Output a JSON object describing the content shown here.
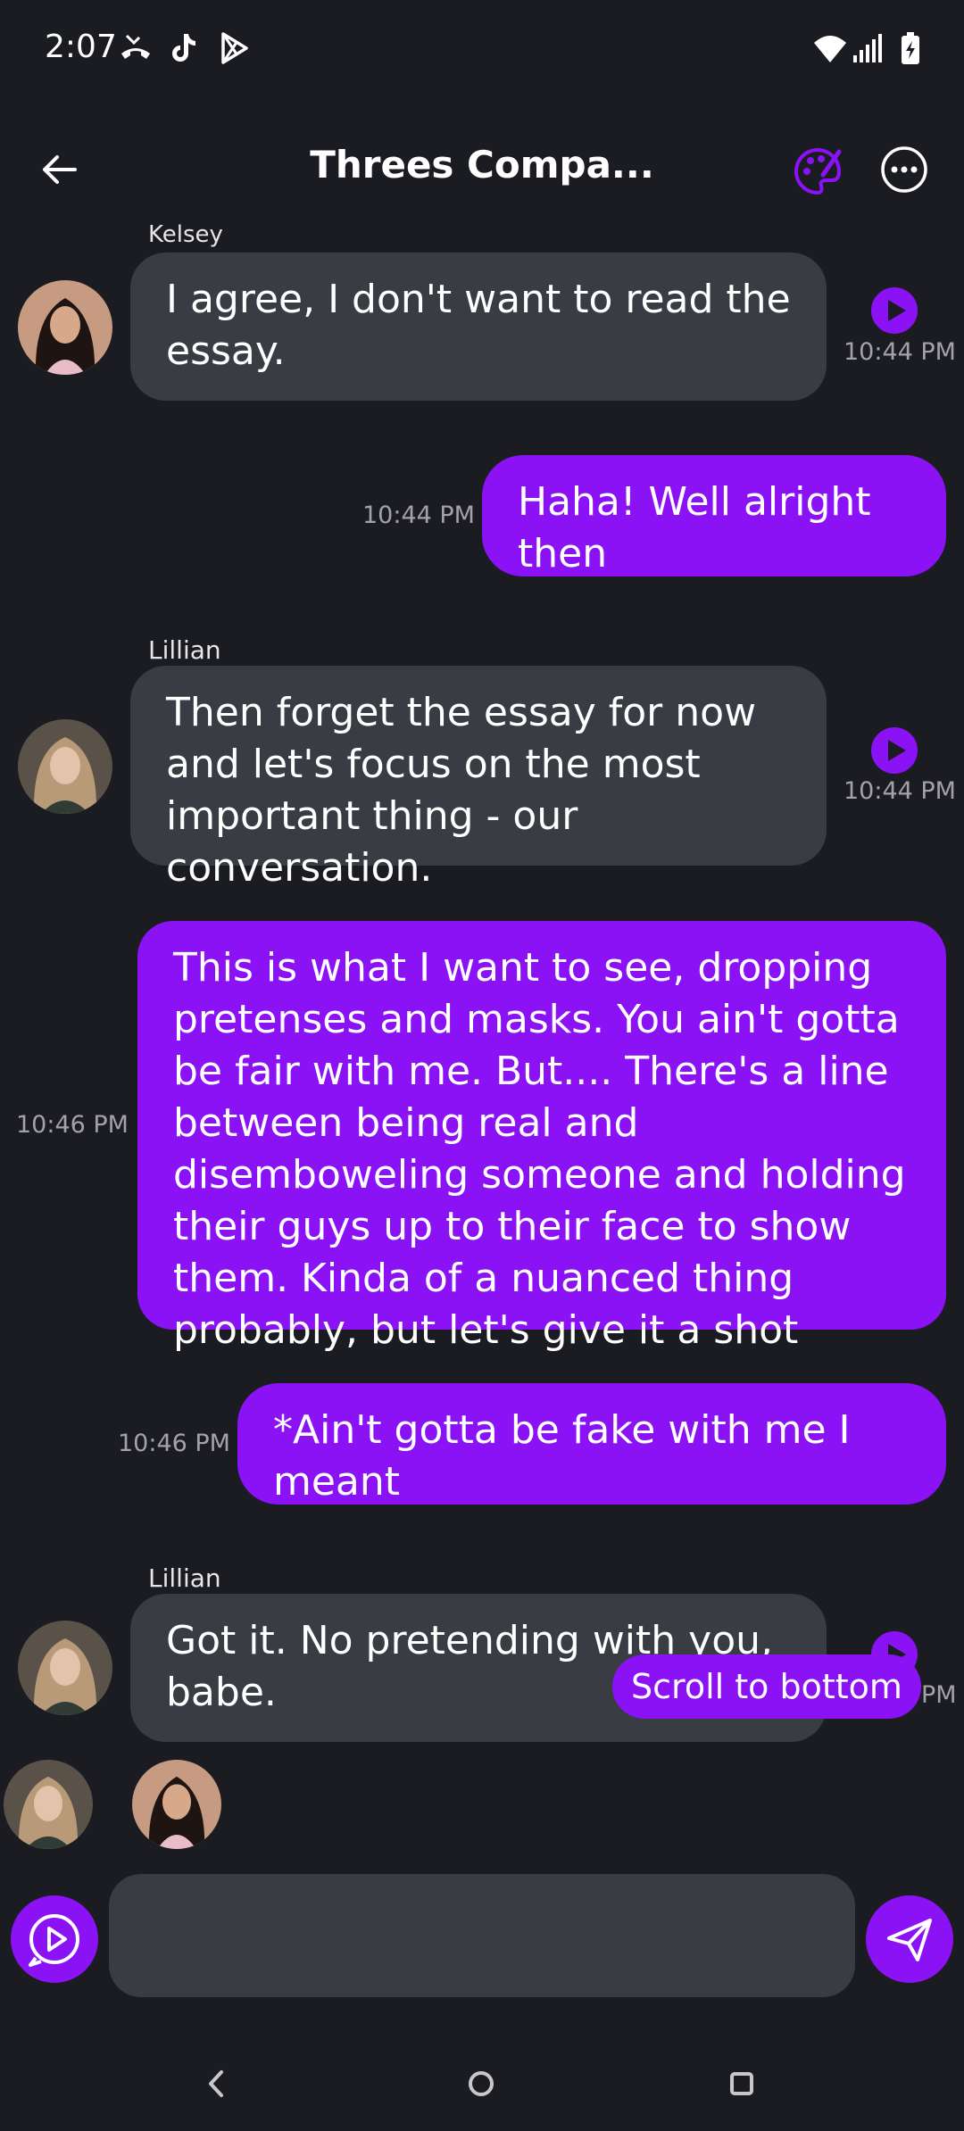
{
  "status_bar": {
    "time": "2:07",
    "icons": [
      "phone-missed-icon",
      "tiktok-icon",
      "play-store-icon",
      "wifi-icon",
      "signal-icon",
      "battery-charging-icon"
    ]
  },
  "header": {
    "title": "Threes Compa...",
    "accent": "#8b12f5",
    "icons": [
      "back-arrow-icon",
      "palette-icon",
      "more-options-icon"
    ]
  },
  "messages": [
    {
      "sender": "Kelsey",
      "role": "incoming",
      "text": "I agree, I don't want to read the essay.",
      "time": "10:44 PM"
    },
    {
      "role": "outgoing",
      "text": "Haha! Well alright then",
      "time": "10:44 PM"
    },
    {
      "sender": "Lillian",
      "role": "incoming",
      "text": "Then forget the essay for now and let's focus on the most important thing - our conversation.",
      "time": "10:44 PM"
    },
    {
      "role": "outgoing",
      "text": "This is what I want to see, dropping pretenses and masks. You ain't gotta be fair with me. But.... There's a line between being real and disemboweling someone and holding their guys up to their face to show them. Kinda of a nuanced thing probably, but let's give it a shot",
      "time": "10:46 PM"
    },
    {
      "role": "outgoing",
      "text": "*Ain't gotta be fake with me I meant",
      "time": "10:46 PM"
    },
    {
      "sender": "Lillian",
      "role": "incoming",
      "text": "Got it. No pretending with you, babe.",
      "time": "PM"
    }
  ],
  "scroll_to_bottom": "Scroll to bottom",
  "composer": {
    "placeholder": "",
    "value": ""
  },
  "colors": {
    "background": "#1b1c22",
    "incoming_bubble": "#3a3c43",
    "outgoing_bubble": "#8b12f5",
    "timestamp": "#a2a2a8"
  }
}
